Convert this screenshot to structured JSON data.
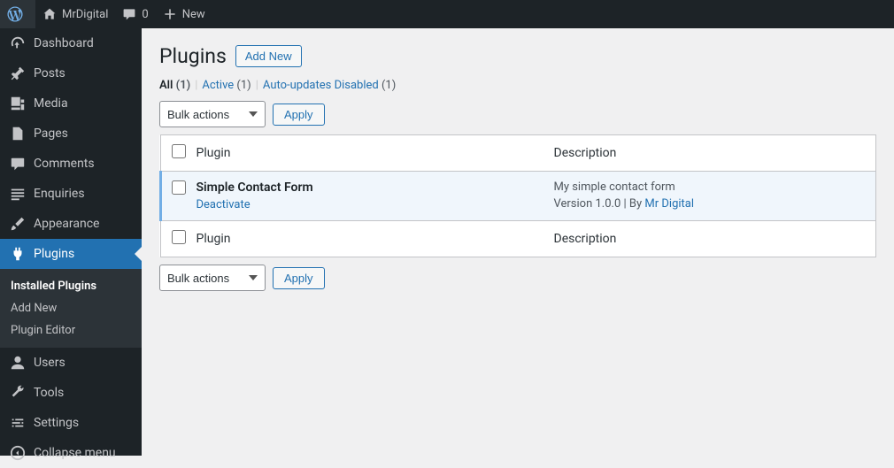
{
  "adminbar": {
    "site_name": "MrDigital",
    "comments_count": "0",
    "new_label": "New"
  },
  "sidebar": {
    "items": [
      {
        "label": "Dashboard"
      },
      {
        "label": "Posts"
      },
      {
        "label": "Media"
      },
      {
        "label": "Pages"
      },
      {
        "label": "Comments"
      },
      {
        "label": "Enquiries"
      },
      {
        "label": "Appearance"
      },
      {
        "label": "Plugins"
      },
      {
        "label": "Users"
      },
      {
        "label": "Tools"
      },
      {
        "label": "Settings"
      },
      {
        "label": "Collapse menu"
      }
    ],
    "submenu": [
      {
        "label": "Installed Plugins"
      },
      {
        "label": "Add New"
      },
      {
        "label": "Plugin Editor"
      }
    ]
  },
  "page": {
    "title": "Plugins",
    "add_new": "Add New"
  },
  "filters": {
    "all_label": "All",
    "all_count": "(1)",
    "active_label": "Active",
    "active_count": "(1)",
    "auto_label": "Auto-updates Disabled",
    "auto_count": "(1)"
  },
  "bulk": {
    "placeholder": "Bulk actions",
    "apply": "Apply"
  },
  "table": {
    "col_plugin": "Plugin",
    "col_description": "Description",
    "rows": [
      {
        "name": "Simple Contact Form",
        "action": "Deactivate",
        "description": "My simple contact form",
        "version_prefix": "Version ",
        "version": "1.0.0",
        "by": " | By ",
        "author": "Mr Digital"
      }
    ]
  }
}
